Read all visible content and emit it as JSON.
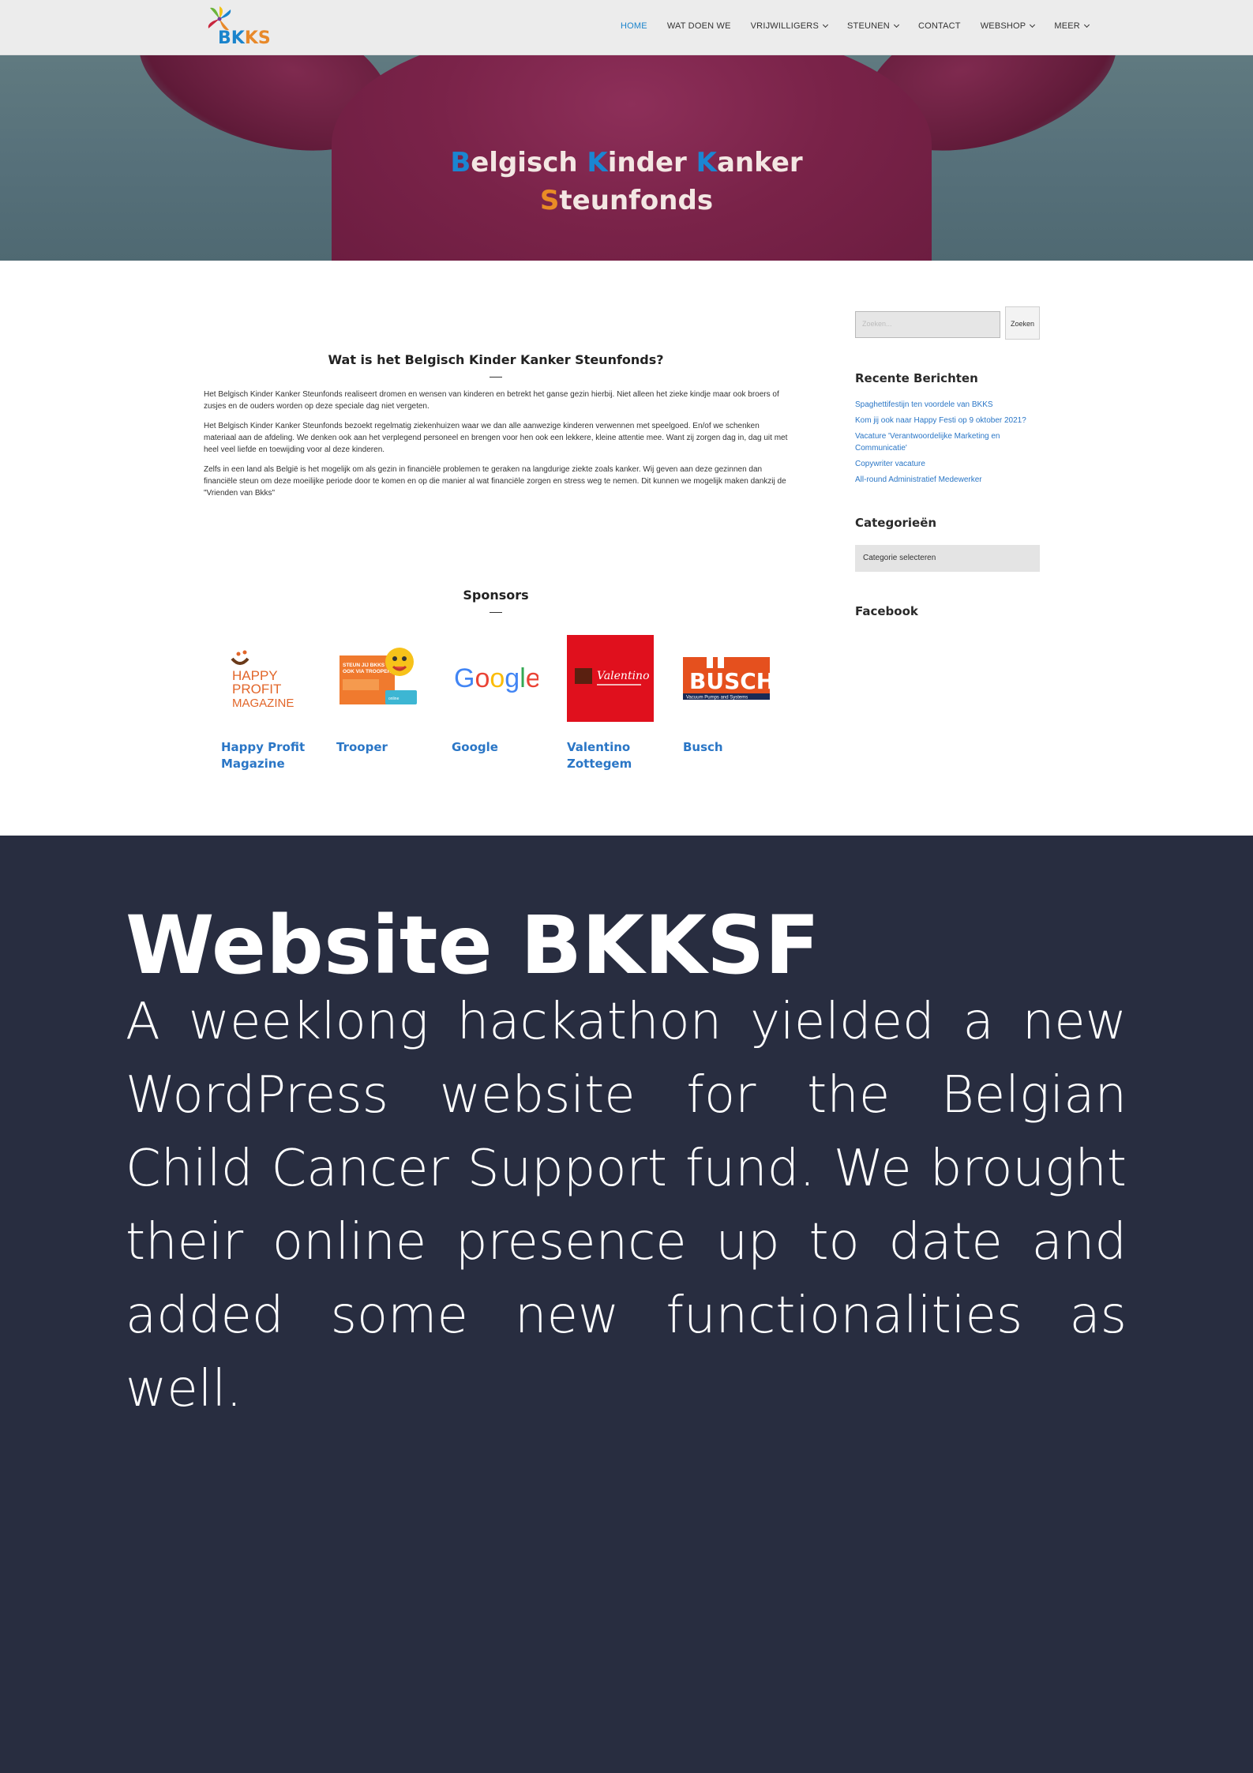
{
  "nav": {
    "logo_text": [
      "B",
      "K",
      "KS"
    ],
    "items": [
      {
        "label": "HOME",
        "active": true,
        "dropdown": false
      },
      {
        "label": "WAT DOEN WE",
        "active": false,
        "dropdown": false
      },
      {
        "label": "VRIJWILLIGERS",
        "active": false,
        "dropdown": true
      },
      {
        "label": "STEUNEN",
        "active": false,
        "dropdown": true
      },
      {
        "label": "CONTACT",
        "active": false,
        "dropdown": false
      },
      {
        "label": "WEBSHOP",
        "active": false,
        "dropdown": true
      },
      {
        "label": "MEER",
        "active": false,
        "dropdown": true
      }
    ]
  },
  "hero": {
    "line1": [
      {
        "t": "B",
        "c": "blue"
      },
      {
        "t": "elgisch ",
        "c": ""
      },
      {
        "t": "K",
        "c": "blue"
      },
      {
        "t": "inder ",
        "c": ""
      },
      {
        "t": "K",
        "c": "blue"
      },
      {
        "t": "anker",
        "c": ""
      }
    ],
    "line2": [
      {
        "t": "S",
        "c": "orange"
      },
      {
        "t": "teunfonds",
        "c": ""
      }
    ]
  },
  "about": {
    "title": "Wat is het Belgisch Kinder Kanker Steunfonds?",
    "paragraphs": [
      "Het Belgisch Kinder Kanker Steunfonds realiseert dromen en wensen van kinderen en betrekt het ganse gezin hierbij. Niet alleen het zieke kindje maar ook broers of zusjes en de ouders worden op deze speciale dag niet vergeten.",
      "Het Belgisch Kinder Kanker Steunfonds bezoekt regelmatig ziekenhuizen waar we dan alle aanwezige kinderen verwennen met speelgoed. En/of we schenken materiaal aan de afdeling. We denken ook aan het verplegend personeel en brengen voor hen ook een lekkere, kleine attentie mee. Want zij zorgen dag in, dag uit met heel veel liefde en toewijding voor al deze kinderen.",
      "Zelfs in een land als België is het mogelijk om als gezin in financiële problemen te geraken na langdurige ziekte zoals kanker. Wij geven aan deze gezinnen dan financiële steun om deze moeilijke periode door te komen en op die manier al wat financiële zorgen en stress weg te nemen. Dit kunnen we mogelijk maken dankzij de \"Vrienden van Bkks\""
    ]
  },
  "sponsors": {
    "title": "Sponsors",
    "items": [
      {
        "name": "Happy Profit Magazine",
        "logo_text": "HAPPY PROFIT MAGAZINE"
      },
      {
        "name": "Trooper",
        "logo_text": "STEUN JIJ BKKS OOK VIA TROOPER?"
      },
      {
        "name": "Google",
        "logo_text": "Google"
      },
      {
        "name": "Valentino Zottegem",
        "logo_text": "Valentino"
      },
      {
        "name": "Busch",
        "logo_text": "BUSCH",
        "logo_sub": "Vacuum Pumps and Systems"
      }
    ]
  },
  "sidebar": {
    "search_placeholder": "Zoeken...",
    "search_button": "Zoeken",
    "recent_title": "Recente Berichten",
    "recent_posts": [
      "Spaghettifestijn ten voordele van BKKS",
      "Kom jij ook naar Happy Festi op 9 oktober 2021?",
      "Vacature 'Verantwoordelijke Marketing en Communicatie'",
      "Copywriter vacature",
      "All-round Administratief Medewerker"
    ],
    "categories_title": "Categorieën",
    "categories_select": "Categorie selecteren",
    "facebook_title": "Facebook"
  },
  "project": {
    "title": "Website BKKSF",
    "description": "A weeklong hackathon yielded a new WordPress website for the Belgian Child Cancer Support fund. We brought their online presence up to date and added some new functionalities as well.",
    "background": "#282d40"
  }
}
